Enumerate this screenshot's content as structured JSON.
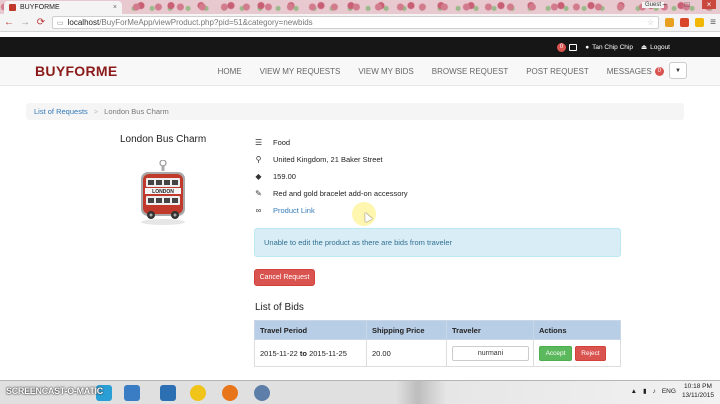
{
  "browser": {
    "tab_title": "BUYFORME",
    "tab_close": "×",
    "url_host": "localhost",
    "url_path": "/BuyForMeApp/viewProduct.php?pid=51&category=newbids",
    "profile_name": "Guest"
  },
  "topbar": {
    "cart_count": "0",
    "user_name": "Tan Chip Chip",
    "logout_label": "Logout"
  },
  "nav": {
    "brand": "BUYFORME",
    "items": [
      {
        "label": "HOME"
      },
      {
        "label": "VIEW MY REQUESTS"
      },
      {
        "label": "VIEW MY BIDS"
      },
      {
        "label": "BROWSE REQUEST"
      },
      {
        "label": "POST REQUEST"
      },
      {
        "label": "MESSAGES"
      }
    ],
    "messages_count": "0"
  },
  "breadcrumb": {
    "parent": "List of Requests",
    "separator": ">",
    "current": "London Bus Charm"
  },
  "product": {
    "title": "London Bus Charm",
    "image_text": "LONDON",
    "category": "Food",
    "location": "United Kingdom, 21 Baker Street",
    "price": "159.00",
    "description": "Red and gold bracelet add-on accessory",
    "link_label": "Product Link"
  },
  "alert": {
    "message": "Unable to edit the product as there are bids from traveler"
  },
  "actions": {
    "cancel_label": "Cancel Request"
  },
  "bids": {
    "title": "List of Bids",
    "headers": [
      "Travel Period",
      "Shipping Price",
      "Traveler",
      "Actions"
    ],
    "rows": [
      {
        "from": "2015-11-22",
        "to_word": "to",
        "to": "2015-11-25",
        "shipping": "20.00",
        "traveler": "nurmani",
        "accept_label": "Accept",
        "reject_label": "Reject"
      }
    ]
  },
  "taskbar": {
    "watermark": "SCREENCAST-O-MATIC",
    "language": "ENG",
    "time": "10:18 PM",
    "date": "13/11/2015"
  },
  "colors": {
    "brand": "#8b1a1a",
    "topbar": "#161616",
    "danger": "#d9534f",
    "success": "#5cb85c",
    "info_bg": "#d9edf7",
    "link": "#337ab7",
    "table_header": "#b8cde6"
  }
}
